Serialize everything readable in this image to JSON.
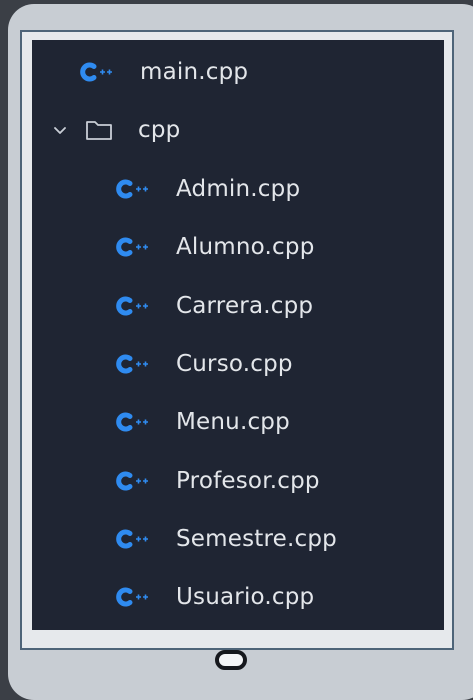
{
  "explorer": {
    "root_file": {
      "label": "main.cpp",
      "icon": "cpp-file-icon"
    },
    "folder": {
      "label": "cpp",
      "expanded": true,
      "toggle_icon": "chevron-down-icon",
      "icon": "folder-icon",
      "files": [
        {
          "label": "Admin.cpp",
          "icon": "cpp-file-icon"
        },
        {
          "label": "Alumno.cpp",
          "icon": "cpp-file-icon"
        },
        {
          "label": "Carrera.cpp",
          "icon": "cpp-file-icon"
        },
        {
          "label": "Curso.cpp",
          "icon": "cpp-file-icon"
        },
        {
          "label": "Menu.cpp",
          "icon": "cpp-file-icon"
        },
        {
          "label": "Profesor.cpp",
          "icon": "cpp-file-icon"
        },
        {
          "label": "Semestre.cpp",
          "icon": "cpp-file-icon"
        },
        {
          "label": "Usuario.cpp",
          "icon": "cpp-file-icon"
        }
      ]
    }
  },
  "colors": {
    "panel_background": "#1f2533",
    "text": "#e3e6ea",
    "cpp_icon": "#2f8bf0",
    "device_body": "#c8cdd3",
    "page_background": "#3b3f46"
  }
}
